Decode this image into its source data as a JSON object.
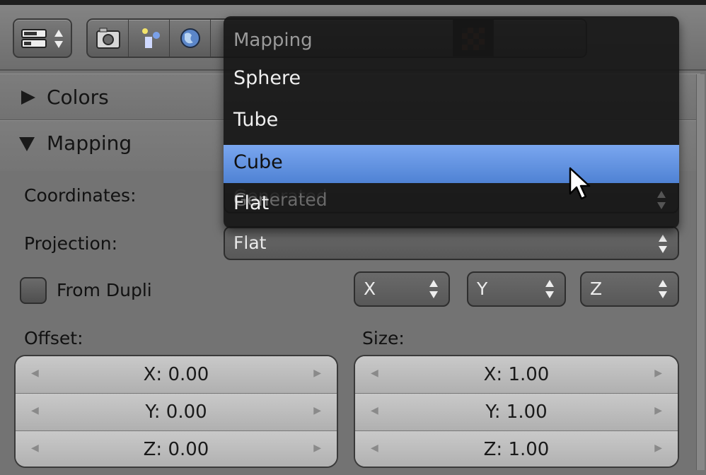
{
  "panels": {
    "colors": {
      "title": "Colors",
      "expanded": false
    },
    "mapping": {
      "title": "Mapping",
      "expanded": true,
      "coordinates_label": "Coordinates:",
      "coordinates_value": "Generated",
      "projection_label": "Projection:",
      "projection_value": "Flat",
      "from_dupli_label": "From Dupli",
      "from_dupli_checked": false,
      "axes": [
        "X",
        "Y",
        "Z"
      ],
      "offset_label": "Offset:",
      "offset": [
        "X: 0.00",
        "Y: 0.00",
        "Z: 0.00"
      ],
      "size_label": "Size:",
      "size": [
        "X: 1.00",
        "Y: 1.00",
        "Z: 1.00"
      ]
    }
  },
  "dropdown": {
    "title": "Mapping",
    "items": [
      "Sphere",
      "Tube",
      "Cube",
      "Flat"
    ],
    "highlighted": "Cube"
  },
  "icons": {
    "editor_type": "properties-editor-icon",
    "tabs": [
      "render-icon",
      "scene-icon",
      "world-icon",
      "texture-icon"
    ]
  },
  "colors": {
    "highlight": "#5b8ee0",
    "menu_bg": "#141414",
    "panel_bg": "#737373"
  }
}
